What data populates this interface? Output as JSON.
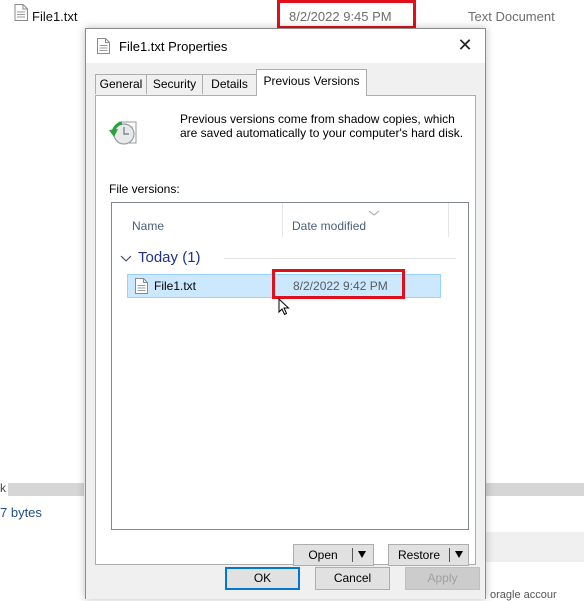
{
  "background": {
    "file_name": "File1.txt",
    "date_modified": "8/2/2022 9:45 PM",
    "file_type": "Text Document",
    "fragment_k": "k",
    "size_fragment": "7 bytes",
    "cut_text": "oragle accour"
  },
  "dialog": {
    "title": "File1.txt Properties",
    "close_glyph": "✕",
    "tabs": [
      {
        "label": "General"
      },
      {
        "label": "Security"
      },
      {
        "label": "Details"
      },
      {
        "label": "Previous Versions",
        "active": true
      }
    ],
    "info_text": "Previous versions come from shadow copies, which are saved automatically to your computer's hard disk.",
    "versions_label": "File versions:",
    "columns": {
      "name": "Name",
      "date_modified": "Date modified"
    },
    "group": {
      "label": "Today (1)"
    },
    "rows": [
      {
        "name": "File1.txt",
        "date_modified": "8/2/2022 9:42 PM",
        "selected": true
      }
    ],
    "open_button": "Open",
    "restore_button": "Restore",
    "ok_button": "OK",
    "cancel_button": "Cancel",
    "apply_button": "Apply"
  },
  "colors": {
    "highlight_border": "#e0101a",
    "selection_bg": "#cce8ff",
    "group_header": "#1e3287"
  }
}
